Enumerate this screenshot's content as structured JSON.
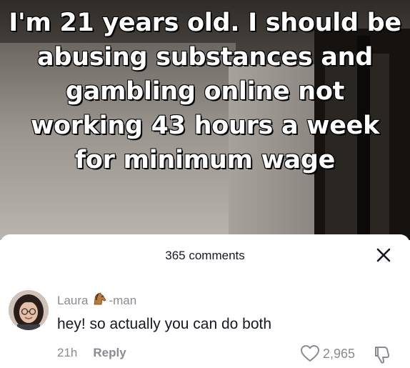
{
  "video": {
    "caption": "I'm 21 years old. I should be abusing substances and gambling online not working 43 hours a week for minimum wage"
  },
  "comments_panel": {
    "title": "365 comments",
    "close_icon": "close-icon"
  },
  "comment": {
    "username_prefix": "Laura",
    "username_suffix": "-man",
    "username_emoji_icon": "horse-icon",
    "text": "hey! so actually you can do both",
    "age": "21h",
    "reply_label": "Reply",
    "like_count": "2,965",
    "like_icon": "heart-outline-icon",
    "dislike_icon": "thumbs-down-icon"
  }
}
